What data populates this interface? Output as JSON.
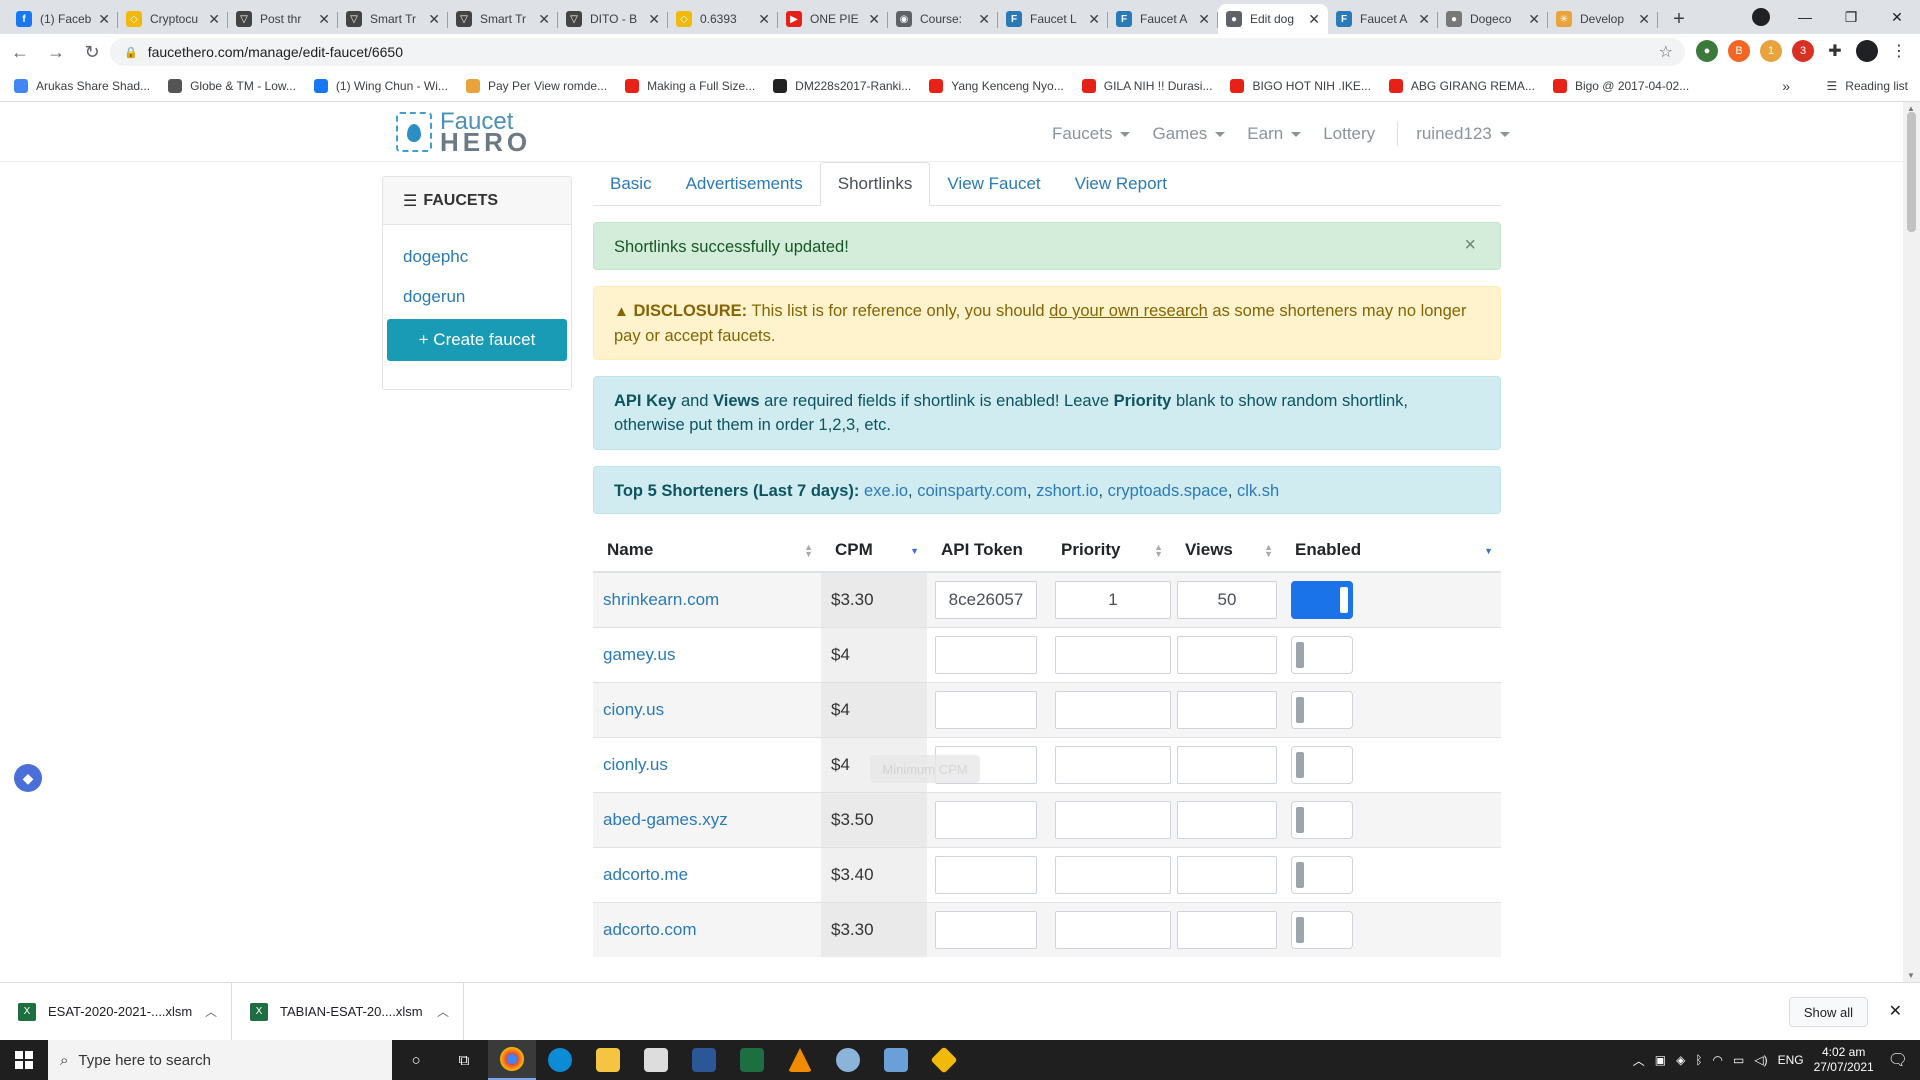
{
  "browser": {
    "tabs": [
      {
        "title": "(1) Faceb",
        "color": "#1877f2",
        "glyph": "f"
      },
      {
        "title": "Cryptocu",
        "color": "#f0b90b",
        "glyph": "◇"
      },
      {
        "title": "Post thr",
        "color": "#444",
        "glyph": "▽"
      },
      {
        "title": "Smart Tr",
        "color": "#444",
        "glyph": "▽"
      },
      {
        "title": "Smart Tr",
        "color": "#444",
        "glyph": "▽"
      },
      {
        "title": "DITO - B",
        "color": "#444",
        "glyph": "▽"
      },
      {
        "title": "0.6393",
        "color": "#f0b90b",
        "glyph": "◇"
      },
      {
        "title": "ONE PIE",
        "color": "#e62117",
        "glyph": "▶"
      },
      {
        "title": "Course:",
        "color": "#5f6368",
        "glyph": "◉"
      },
      {
        "title": "Faucet L",
        "color": "#2a7ab8",
        "glyph": "F"
      },
      {
        "title": "Faucet A",
        "color": "#2a7ab8",
        "glyph": "F"
      },
      {
        "title": "Edit dog",
        "color": "#5f6368",
        "glyph": "●",
        "active": true
      },
      {
        "title": "Faucet A",
        "color": "#2a7ab8",
        "glyph": "F"
      },
      {
        "title": "Dogeco",
        "color": "#777",
        "glyph": "●"
      },
      {
        "title": "Develop",
        "color": "#e8a33d",
        "glyph": "✳"
      }
    ],
    "url": "faucethero.com/manage/edit-faucet/6650",
    "bookmarks": [
      {
        "label": "Arukas Share Shad...",
        "color": "#4285f4"
      },
      {
        "label": "Globe & TM - Low...",
        "color": "#555"
      },
      {
        "label": "(1) Wing Chun - Wi...",
        "color": "#1877f2"
      },
      {
        "label": "Pay Per View romde...",
        "color": "#e8a33d"
      },
      {
        "label": "Making a Full Size...",
        "color": "#e62117"
      },
      {
        "label": "DM228s2017-Ranki...",
        "color": "#222"
      },
      {
        "label": "Yang Kenceng Nyo...",
        "color": "#e62117"
      },
      {
        "label": "GILA NIH !! Durasi...",
        "color": "#e62117"
      },
      {
        "label": "BIGO HOT NIH .IKE...",
        "color": "#e62117"
      },
      {
        "label": "ABG GIRANG REMA...",
        "color": "#e62117"
      },
      {
        "label": "Bigo @ 2017-04-02...",
        "color": "#e62117"
      }
    ],
    "more": "»",
    "reading_list": "Reading list"
  },
  "site": {
    "logo_top": "Faucet",
    "logo_bottom": "HERO",
    "menu": [
      {
        "label": "Faucets",
        "dropdown": true
      },
      {
        "label": "Games",
        "dropdown": true
      },
      {
        "label": "Earn",
        "dropdown": true
      },
      {
        "label": "Lottery",
        "dropdown": false
      }
    ],
    "user": "ruined123"
  },
  "sidebar": {
    "title": "FAUCETS",
    "items": [
      "dogephc",
      "dogerun"
    ],
    "create": "+ Create faucet"
  },
  "tabs": [
    {
      "label": "Basic",
      "active": false
    },
    {
      "label": "Advertisements",
      "active": false
    },
    {
      "label": "Shortlinks",
      "active": true
    },
    {
      "label": "View Faucet",
      "active": false
    },
    {
      "label": "View Report",
      "active": false
    }
  ],
  "alerts": {
    "success": "Shortlinks successfully updated!",
    "close": "×",
    "disclosure_label": "DISCLOSURE:",
    "disclosure_pre": " This list is for reference only, you should ",
    "disclosure_link": "do your own research",
    "disclosure_post": " as some shorteners may no longer pay or accept faucets.",
    "info_b1": "API Key",
    "info_t1": " and ",
    "info_b2": "Views",
    "info_t2": " are required fields if shortlink is enabled! Leave ",
    "info_b3": "Priority",
    "info_t3": " blank to show random shortlink, otherwise put them in order 1,2,3, etc.",
    "top5_label": "Top 5 Shorteners (Last 7 days):",
    "top5": [
      "exe.io",
      "coinsparty.com",
      "zshort.io",
      "cryptoads.space",
      "clk.sh"
    ]
  },
  "table": {
    "headers": [
      "Name",
      "CPM",
      "API Token",
      "Priority",
      "Views",
      "Enabled"
    ],
    "rows": [
      {
        "name": "shrinkearn.com",
        "cpm": "$3.30",
        "token": "8ce26057",
        "priority": "1",
        "views": "50",
        "enabled": true
      },
      {
        "name": "gamey.us",
        "cpm": "$4",
        "token": "",
        "priority": "",
        "views": "",
        "enabled": false
      },
      {
        "name": "ciony.us",
        "cpm": "$4",
        "token": "",
        "priority": "",
        "views": "",
        "enabled": false
      },
      {
        "name": "cionly.us",
        "cpm": "$4",
        "token": "",
        "priority": "",
        "views": "",
        "enabled": false
      },
      {
        "name": "abed-games.xyz",
        "cpm": "$3.50",
        "token": "",
        "priority": "",
        "views": "",
        "enabled": false
      },
      {
        "name": "adcorto.me",
        "cpm": "$3.40",
        "token": "",
        "priority": "",
        "views": "",
        "enabled": false
      },
      {
        "name": "adcorto.com",
        "cpm": "$3.30",
        "token": "",
        "priority": "",
        "views": "",
        "enabled": false
      }
    ],
    "tooltip": "Minimum CPM"
  },
  "downloads": {
    "items": [
      "ESAT-2020-2021-....xlsm",
      "TABIAN-ESAT-20....xlsm"
    ],
    "show_all": "Show all"
  },
  "taskbar": {
    "search_placeholder": "Type here to search",
    "lang": "ENG",
    "time": "4:02 am",
    "date": "27/07/2021"
  }
}
